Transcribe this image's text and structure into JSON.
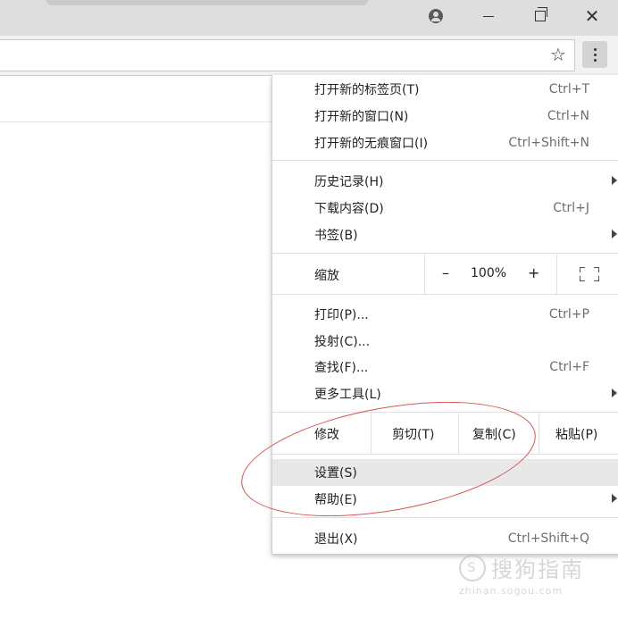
{
  "menu": {
    "group1": [
      {
        "label": "打开新的标签页(T)",
        "shortcut": "Ctrl+T"
      },
      {
        "label": "打开新的窗口(N)",
        "shortcut": "Ctrl+N"
      },
      {
        "label": "打开新的无痕窗口(I)",
        "shortcut": "Ctrl+Shift+N"
      }
    ],
    "group2": [
      {
        "label": "历史记录(H)",
        "shortcut": ""
      },
      {
        "label": "下载内容(D)",
        "shortcut": "Ctrl+J"
      },
      {
        "label": "书签(B)",
        "shortcut": ""
      }
    ],
    "zoom": {
      "label": "缩放",
      "minus": "–",
      "value": "100%",
      "plus": "+"
    },
    "group3": [
      {
        "label": "打印(P)...",
        "shortcut": "Ctrl+P"
      },
      {
        "label": "投射(C)...",
        "shortcut": ""
      },
      {
        "label": "查找(F)...",
        "shortcut": "Ctrl+F"
      },
      {
        "label": "更多工具(L)",
        "shortcut": ""
      }
    ],
    "edit": {
      "label": "修改",
      "cut": "剪切(T)",
      "copy": "复制(C)",
      "paste": "粘贴(P)"
    },
    "group4": [
      {
        "label": "设置(S)",
        "shortcut": ""
      },
      {
        "label": "帮助(E)",
        "shortcut": ""
      }
    ],
    "exit": {
      "label": "退出(X)",
      "shortcut": "Ctrl+Shift+Q"
    }
  },
  "toolbar": {
    "bookmark_icon": "☆",
    "menu_icon": "more-vert-icon"
  },
  "window": {
    "minimize": "—",
    "close": "✕"
  },
  "watermark": {
    "cn": "搜狗指南",
    "logo": "S",
    "en": "zhinan.sogou.com"
  },
  "colors": {
    "annotation_oval": "#d9534f",
    "highlight": "#e8e8e8"
  }
}
